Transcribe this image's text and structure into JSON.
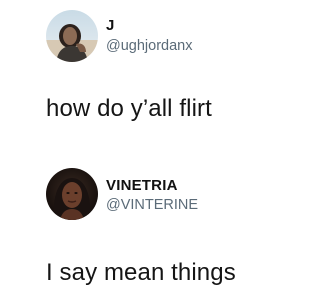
{
  "posts": [
    {
      "display_name": "J",
      "handle": "@ughjordanx",
      "text": "how do y’all flirt",
      "avatar_icon": "profile-photo"
    },
    {
      "display_name": "VINETRIA",
      "handle": "@VINTERINE",
      "text": "I say mean things",
      "avatar_icon": "profile-photo"
    }
  ],
  "colors": {
    "background": "#ffffff",
    "text": "#111111",
    "handle": "#5b6b78"
  }
}
